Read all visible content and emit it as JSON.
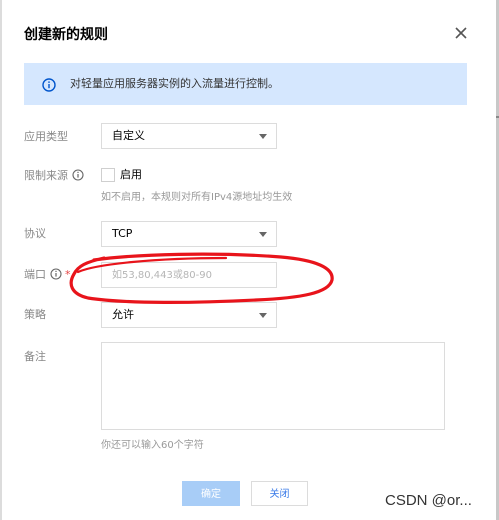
{
  "dialog": {
    "title": "创建新的规则",
    "close_icon": "close-icon"
  },
  "info": {
    "icon": "info-circle-icon",
    "text": "对轻量应用服务器实例的入流量进行控制。",
    "background": "#d5e7fe",
    "icon_color": "#0055cc"
  },
  "form": {
    "app_type": {
      "label": "应用类型",
      "value": "自定义"
    },
    "source": {
      "label": "限制来源",
      "help_icon": "help-circle-icon",
      "checkbox_label": "启用",
      "checked": false,
      "hint": "如不启用，本规则对所有IPv4源地址均生效"
    },
    "protocol": {
      "label": "协议",
      "value": "TCP"
    },
    "port": {
      "label": "端口",
      "help_icon": "help-circle-icon",
      "required_mark": "*",
      "value": "",
      "placeholder": "如53,80,443或80-90"
    },
    "policy": {
      "label": "策略",
      "value": "允许"
    },
    "remark": {
      "label": "备注",
      "value": "",
      "hint": "你还可以输入60个字符"
    }
  },
  "footer": {
    "ok_label": "确定",
    "close_label": "关闭",
    "ok_color": "#a8cdf7",
    "link_color": "#3a7be8"
  },
  "annotation": {
    "color": "#e8141b"
  },
  "watermark": {
    "text": "CSDN @or..."
  }
}
